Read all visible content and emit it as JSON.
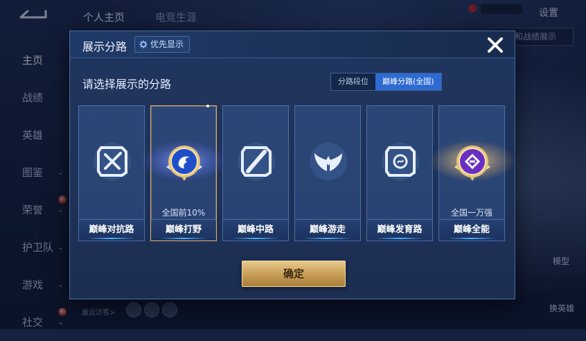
{
  "background": {
    "top_nav": [
      "个人主页",
      "电竞生涯"
    ],
    "settings_label": "设置",
    "display_button_label": "定和战绩展示",
    "side_nav": [
      {
        "label": "主页",
        "active": true,
        "chevron": false,
        "badge": false
      },
      {
        "label": "战绩",
        "active": false,
        "chevron": false,
        "badge": false
      },
      {
        "label": "英雄",
        "active": false,
        "chevron": false,
        "badge": false
      },
      {
        "label": "图鉴",
        "active": false,
        "chevron": true,
        "badge": false
      },
      {
        "label": "荣誉",
        "active": false,
        "chevron": true,
        "badge": true
      },
      {
        "label": "护卫队",
        "active": false,
        "chevron": true,
        "badge": false
      },
      {
        "label": "游戏",
        "active": false,
        "chevron": true,
        "badge": false
      },
      {
        "label": "社交",
        "active": false,
        "chevron": true,
        "badge": true
      }
    ],
    "badge_text": "新",
    "recent_visitors_label": "最近访客>",
    "model_label": "模型",
    "switch_hero_label": "换英雄"
  },
  "modal": {
    "title": "展示分路",
    "priority_button_label": "优先显示",
    "subtitle": "请选择展示的分路",
    "tabs": [
      {
        "label": "分路段位",
        "active": false
      },
      {
        "label": "巅峰分路(全国)",
        "active": true
      }
    ],
    "lanes": [
      {
        "name": "巅峰对抗路",
        "rank": "",
        "selected": false,
        "icon": "crossed-swords-icon",
        "style": "silver"
      },
      {
        "name": "巅峰打野",
        "rank": "全国前10%",
        "selected": true,
        "icon": "dragon-emblem-icon",
        "style": "gold-blue"
      },
      {
        "name": "巅峰中路",
        "rank": "",
        "selected": false,
        "icon": "slash-staff-icon",
        "style": "silver"
      },
      {
        "name": "巅峰游走",
        "rank": "",
        "selected": false,
        "icon": "wings-icon",
        "style": "silver"
      },
      {
        "name": "巅峰发育路",
        "rank": "",
        "selected": false,
        "icon": "target-icon",
        "style": "silver"
      },
      {
        "name": "巅峰全能",
        "rank": "全国一万强",
        "selected": false,
        "icon": "allround-emblem-icon",
        "style": "gold-purple"
      }
    ],
    "confirm_label": "确定"
  },
  "colors": {
    "accent_blue": "#2d6bd0",
    "gold": "#c59c55",
    "card_border": "#4b6ea9"
  }
}
